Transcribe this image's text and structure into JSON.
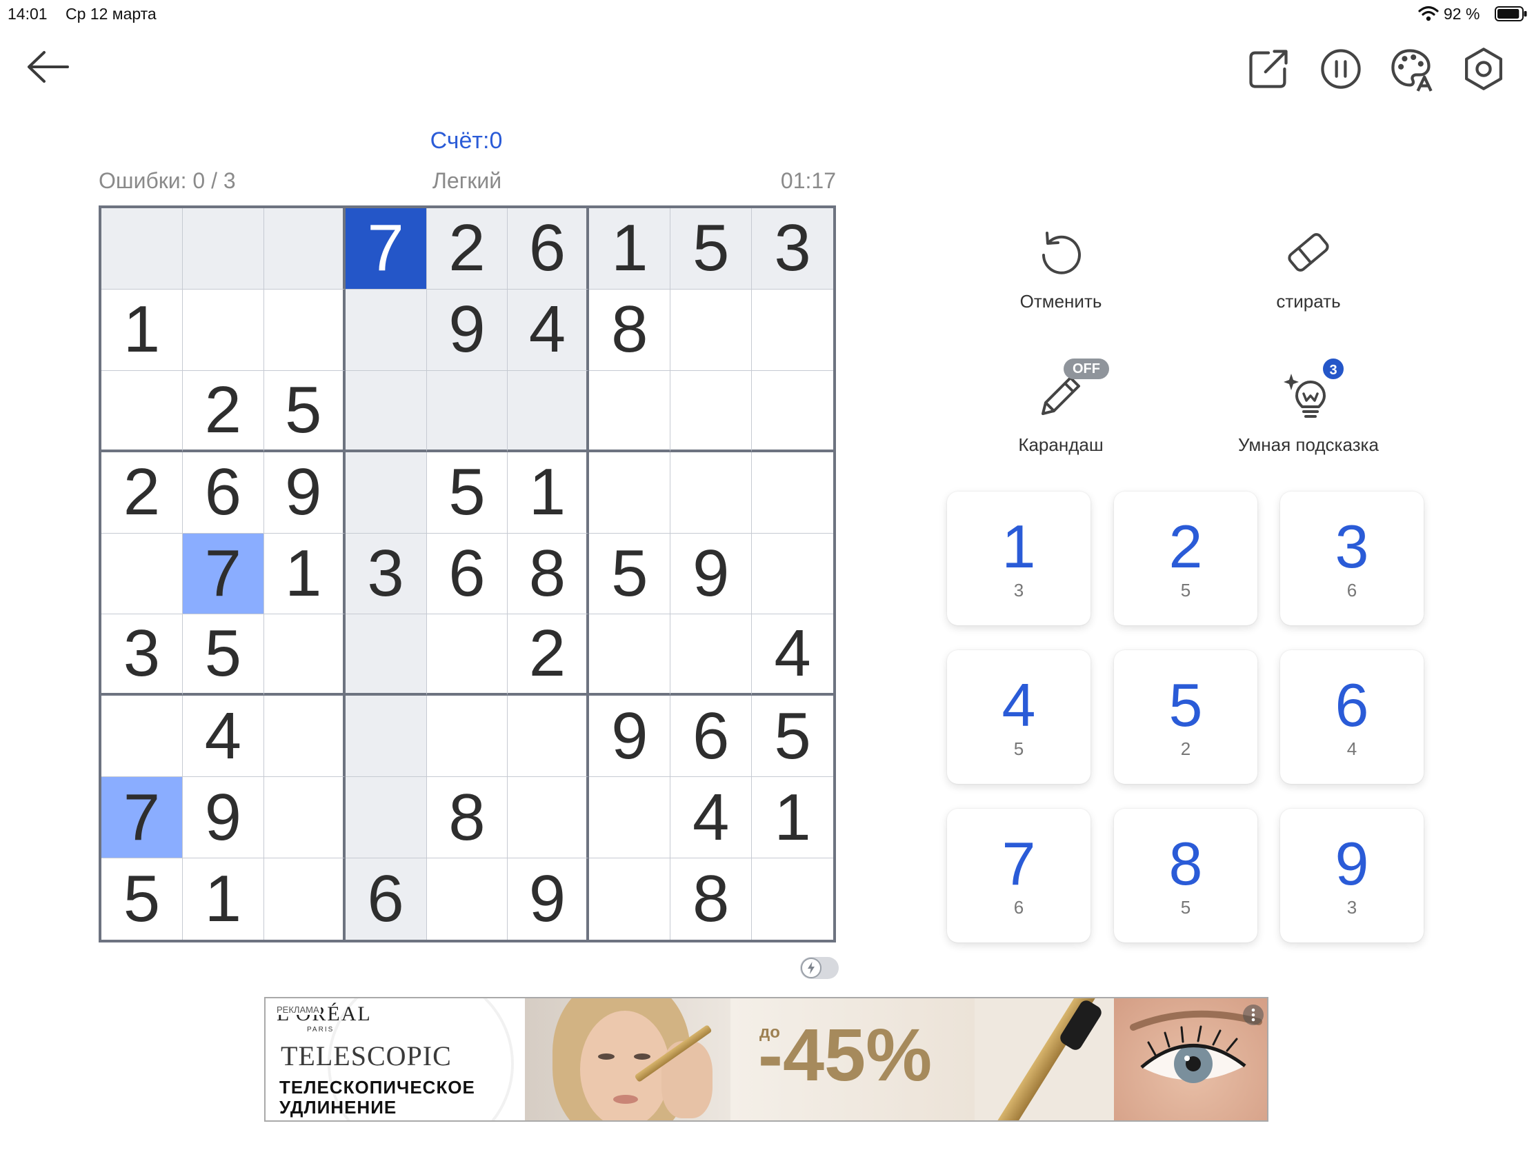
{
  "status_bar": {
    "time": "14:01",
    "date": "Ср 12 марта",
    "battery": "92 %",
    "battery_fill": 0.92
  },
  "icons": {
    "back": "arrow-left-icon",
    "share": "share-icon",
    "pause": "pause-icon",
    "theme": "palette-icon",
    "settings": "settings-icon",
    "undo": "undo-icon",
    "erase": "eraser-icon",
    "pencil": "pencil-icon",
    "hint": "lightbulb-icon",
    "wifi": "wifi-icon",
    "battery": "battery-icon",
    "toggle": "lightning-icon"
  },
  "score": {
    "label": "Счёт:",
    "value": "0"
  },
  "info": {
    "mistakes": "Ошибки: 0 / 3",
    "difficulty": "Легкий",
    "timer": "01:17"
  },
  "grid": {
    "cells": [
      [
        0,
        0,
        0,
        7,
        2,
        6,
        1,
        5,
        3
      ],
      [
        1,
        0,
        0,
        0,
        9,
        4,
        8,
        0,
        0
      ],
      [
        0,
        2,
        5,
        0,
        0,
        0,
        0,
        0,
        0
      ],
      [
        2,
        6,
        9,
        0,
        5,
        1,
        0,
        0,
        0
      ],
      [
        0,
        7,
        1,
        3,
        6,
        8,
        5,
        9,
        0
      ],
      [
        3,
        5,
        0,
        0,
        0,
        2,
        0,
        0,
        4
      ],
      [
        0,
        4,
        0,
        0,
        0,
        0,
        9,
        6,
        5
      ],
      [
        7,
        9,
        0,
        0,
        8,
        0,
        0,
        4,
        1
      ],
      [
        5,
        1,
        0,
        6,
        0,
        9,
        0,
        8,
        0
      ]
    ],
    "selected": {
      "row": 0,
      "col": 3
    }
  },
  "actions": {
    "undo": "Отменить",
    "erase": "стирать",
    "pencil": "Карандаш",
    "pencil_state": "OFF",
    "hint": "Умная подсказка",
    "hint_count": "3"
  },
  "number_pad": [
    {
      "digit": "1",
      "count": "3"
    },
    {
      "digit": "2",
      "count": "5"
    },
    {
      "digit": "3",
      "count": "6"
    },
    {
      "digit": "4",
      "count": "5"
    },
    {
      "digit": "5",
      "count": "2"
    },
    {
      "digit": "6",
      "count": "4"
    },
    {
      "digit": "7",
      "count": "6"
    },
    {
      "digit": "8",
      "count": "5"
    },
    {
      "digit": "9",
      "count": "3"
    }
  ],
  "ad": {
    "label": "РЕКЛАМА",
    "brand": "L'ORÉAL",
    "brand_sub": "PARIS",
    "product": "TELESCOPIC",
    "tagline_1": "ТЕЛЕСКОПИЧЕСКОЕ",
    "tagline_2": "УДЛИНЕНИЕ",
    "discount_prefix": "до",
    "discount": "-45%"
  },
  "colors": {
    "accent": "#2a5bd7",
    "selected_cell": "#2456c8",
    "same_number_cell": "#8aadff",
    "related_cell": "#eceef2",
    "badge_blue": "#2456c8",
    "badge_gray": "#8f949b",
    "discount_gold": "#a68a5c"
  }
}
